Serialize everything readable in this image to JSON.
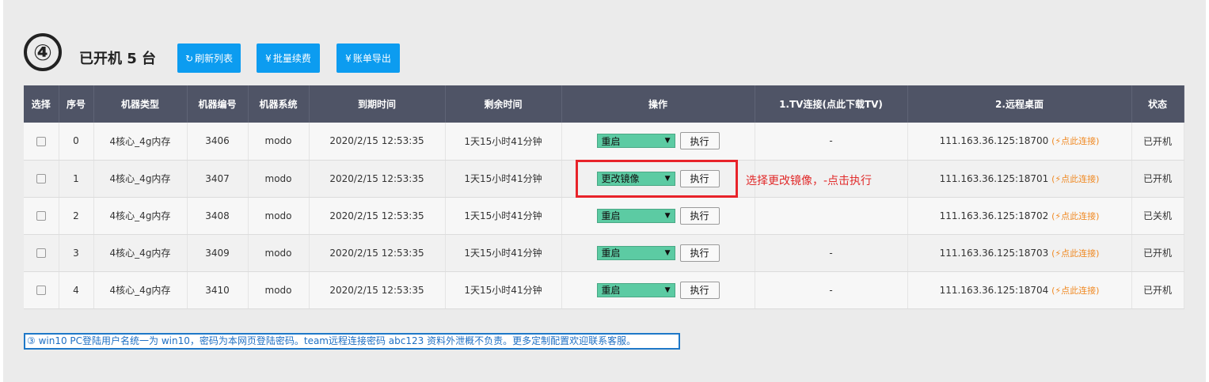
{
  "header": {
    "step": "④",
    "title": "已开机 5 台",
    "buttons": [
      {
        "icon": "↻",
        "icon_name": "refresh-icon",
        "label": "刷新列表"
      },
      {
        "icon": "¥",
        "icon_name": "yen-icon",
        "label": "批量续费"
      },
      {
        "icon": "¥",
        "icon_name": "yen-icon",
        "label": "账单导出"
      }
    ]
  },
  "table": {
    "columns": [
      "选择",
      "序号",
      "机器类型",
      "机器编号",
      "机器系统",
      "到期时间",
      "剩余时间",
      "操作",
      "1.TV连接(点此下载TV)",
      "2.远程桌面",
      "状态"
    ],
    "execute_label": "执行",
    "connect_label": "(⚡点此连接)",
    "rows": [
      {
        "index": "0",
        "type": "4核心_4g内存",
        "id": "3406",
        "os": "modo",
        "expires": "2020/2/15 12:53:35",
        "remaining": "1天15小时41分钟",
        "action": "重启",
        "tv": "-",
        "remote": "111.163.36.125:18700",
        "status": "已开机"
      },
      {
        "index": "1",
        "type": "4核心_4g内存",
        "id": "3407",
        "os": "modo",
        "expires": "2020/2/15 12:53:35",
        "remaining": "1天15小时41分钟",
        "action": "更改镜像",
        "tv": "",
        "remote": "111.163.36.125:18701",
        "status": "已开机"
      },
      {
        "index": "2",
        "type": "4核心_4g内存",
        "id": "3408",
        "os": "modo",
        "expires": "2020/2/15 12:53:35",
        "remaining": "1天15小时41分钟",
        "action": "重启",
        "tv": "",
        "remote": "111.163.36.125:18702",
        "status": "已关机"
      },
      {
        "index": "3",
        "type": "4核心_4g内存",
        "id": "3409",
        "os": "modo",
        "expires": "2020/2/15 12:53:35",
        "remaining": "1天15小时41分钟",
        "action": "重启",
        "tv": "-",
        "remote": "111.163.36.125:18703",
        "status": "已开机"
      },
      {
        "index": "4",
        "type": "4核心_4g内存",
        "id": "3410",
        "os": "modo",
        "expires": "2020/2/15 12:53:35",
        "remaining": "1天15小时41分钟",
        "action": "重启",
        "tv": "-",
        "remote": "111.163.36.125:18704",
        "status": "已开机"
      }
    ]
  },
  "annotation": "选择更改镜像，-点击执行",
  "notice": "③ win10 PC登陆用户名统一为 win10，密码为本网页登陆密码。team远程连接密码 abc123 资料外泄概不负责。更多定制配置欢迎联系客服。",
  "colors": {
    "primary_button": "#0c9cf0",
    "table_header": "#4f5466",
    "select_green": "#5ccba3",
    "annotation_red": "#e12a2a",
    "connect_orange": "#f08a24",
    "notice_blue": "#1e78c8"
  }
}
